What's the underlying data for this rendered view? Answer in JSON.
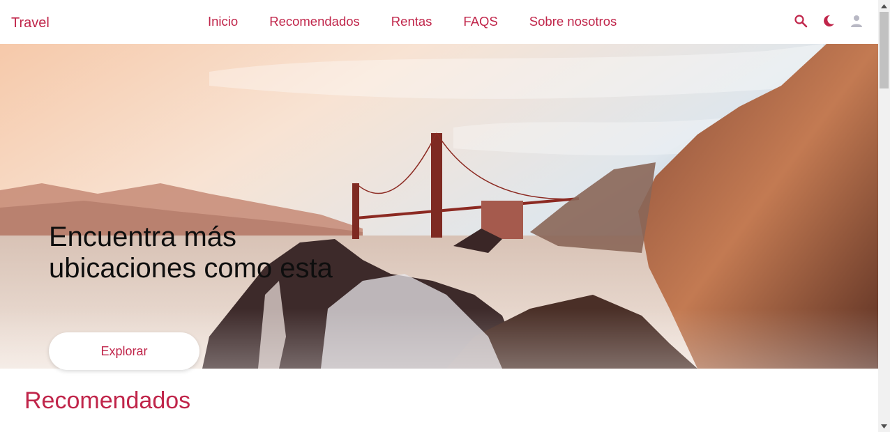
{
  "header": {
    "logo": "Travel",
    "nav": [
      "Inicio",
      "Recomendados",
      "Rentas",
      "FAQS",
      "Sobre nosotros"
    ],
    "icons": [
      "search-icon",
      "moon-icon",
      "user-icon"
    ]
  },
  "hero": {
    "title": "Encuentra más ubicaciones como esta",
    "button": "Explorar"
  },
  "sections": {
    "recommended_title": "Recomendados"
  },
  "colors": {
    "accent": "#c0254a",
    "text_dark": "#0e0e0e"
  }
}
